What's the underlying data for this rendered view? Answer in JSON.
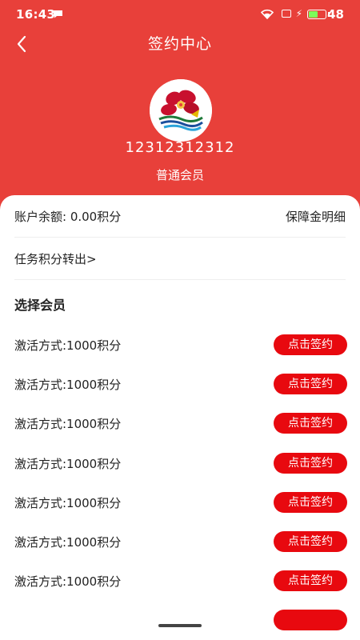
{
  "status_bar": {
    "time": "16:43",
    "battery_level": "48",
    "battery_fraction": 0.48
  },
  "nav": {
    "title": "签约中心"
  },
  "profile": {
    "user_id": "12312312312",
    "member_level": "普通会员"
  },
  "account": {
    "balance_text": "账户余额: 0.00积分",
    "deposit_link": "保障金明细",
    "transfer_link": "任务积分转出>"
  },
  "section": {
    "title": "选择会员"
  },
  "plans": [
    {
      "label": "激活方式:1000积分",
      "button": "点击签约"
    },
    {
      "label": "激活方式:1000积分",
      "button": "点击签约"
    },
    {
      "label": "激活方式:1000积分",
      "button": "点击签约"
    },
    {
      "label": "激活方式:1000积分",
      "button": "点击签约"
    },
    {
      "label": "激活方式:1000积分",
      "button": "点击签约"
    },
    {
      "label": "激活方式:1000积分",
      "button": "点击签约"
    },
    {
      "label": "激活方式:1000积分",
      "button": "点击签约"
    },
    {
      "label": "",
      "button": ""
    }
  ],
  "colors": {
    "header": "#E8403A",
    "button": "#E8090F",
    "text": "#222222"
  }
}
